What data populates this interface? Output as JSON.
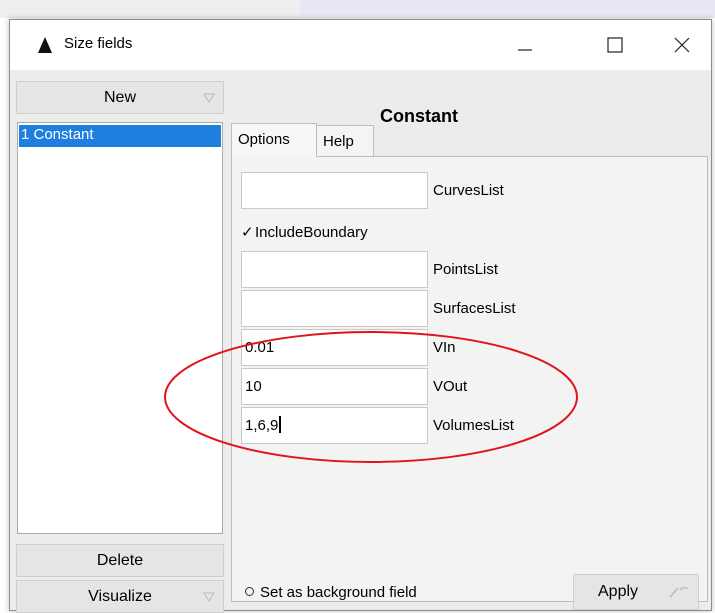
{
  "window": {
    "title": "Size fields"
  },
  "left_panel": {
    "new_label": "New",
    "list_items": [
      "1 Constant"
    ],
    "delete_label": "Delete",
    "visualize_label": "Visualize"
  },
  "right_panel": {
    "title": "Constant",
    "tabs": [
      "Options",
      "Help"
    ],
    "fields": [
      {
        "value": "",
        "label": "CurvesList"
      },
      {
        "value": "",
        "label": "PointsList"
      },
      {
        "value": "",
        "label": "SurfacesList"
      },
      {
        "value": "0.01",
        "label": "VIn"
      },
      {
        "value": "10",
        "label": "VOut"
      },
      {
        "value": "1,6,9",
        "label": "VolumesList"
      }
    ],
    "checkbox": {
      "label": "IncludeBoundary",
      "checked": true,
      "mark": "✓"
    },
    "background_field_label": "Set as background field",
    "apply_label": "Apply"
  },
  "colors": {
    "selection": "#1e7fe0",
    "annotation_ellipse": "#e0141c"
  }
}
